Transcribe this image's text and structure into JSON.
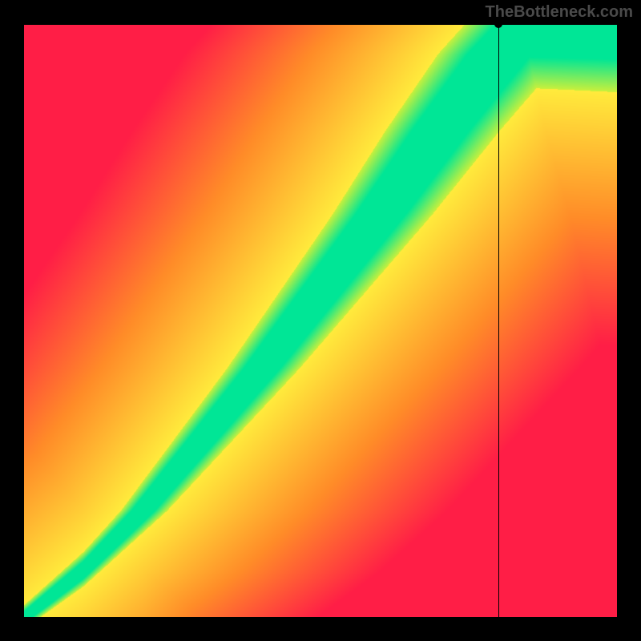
{
  "watermark": "TheBottleneck.com",
  "chart_data": {
    "type": "heatmap",
    "title": "",
    "xlabel": "",
    "ylabel": "",
    "xlim": [
      0,
      100
    ],
    "ylim": [
      0,
      100
    ],
    "colorscale": "red-yellow-green",
    "optimal_curve": {
      "description": "Diagonal green band indicating optimal balance, curves from lower-left to upper-right, widening toward top",
      "points": [
        {
          "x": 0,
          "y": 0
        },
        {
          "x": 10,
          "y": 8
        },
        {
          "x": 20,
          "y": 18
        },
        {
          "x": 30,
          "y": 30
        },
        {
          "x": 40,
          "y": 42
        },
        {
          "x": 50,
          "y": 55
        },
        {
          "x": 60,
          "y": 68
        },
        {
          "x": 70,
          "y": 82
        },
        {
          "x": 80,
          "y": 95
        },
        {
          "x": 85,
          "y": 100
        }
      ]
    },
    "marker": {
      "x": 80,
      "y": 100
    },
    "crosshair": {
      "x": 80,
      "y": 100
    },
    "regions": {
      "left_of_band": "red-to-orange gradient indicating bottleneck",
      "right_of_band": "orange-to-red gradient indicating bottleneck",
      "band": "green indicating balanced"
    }
  }
}
